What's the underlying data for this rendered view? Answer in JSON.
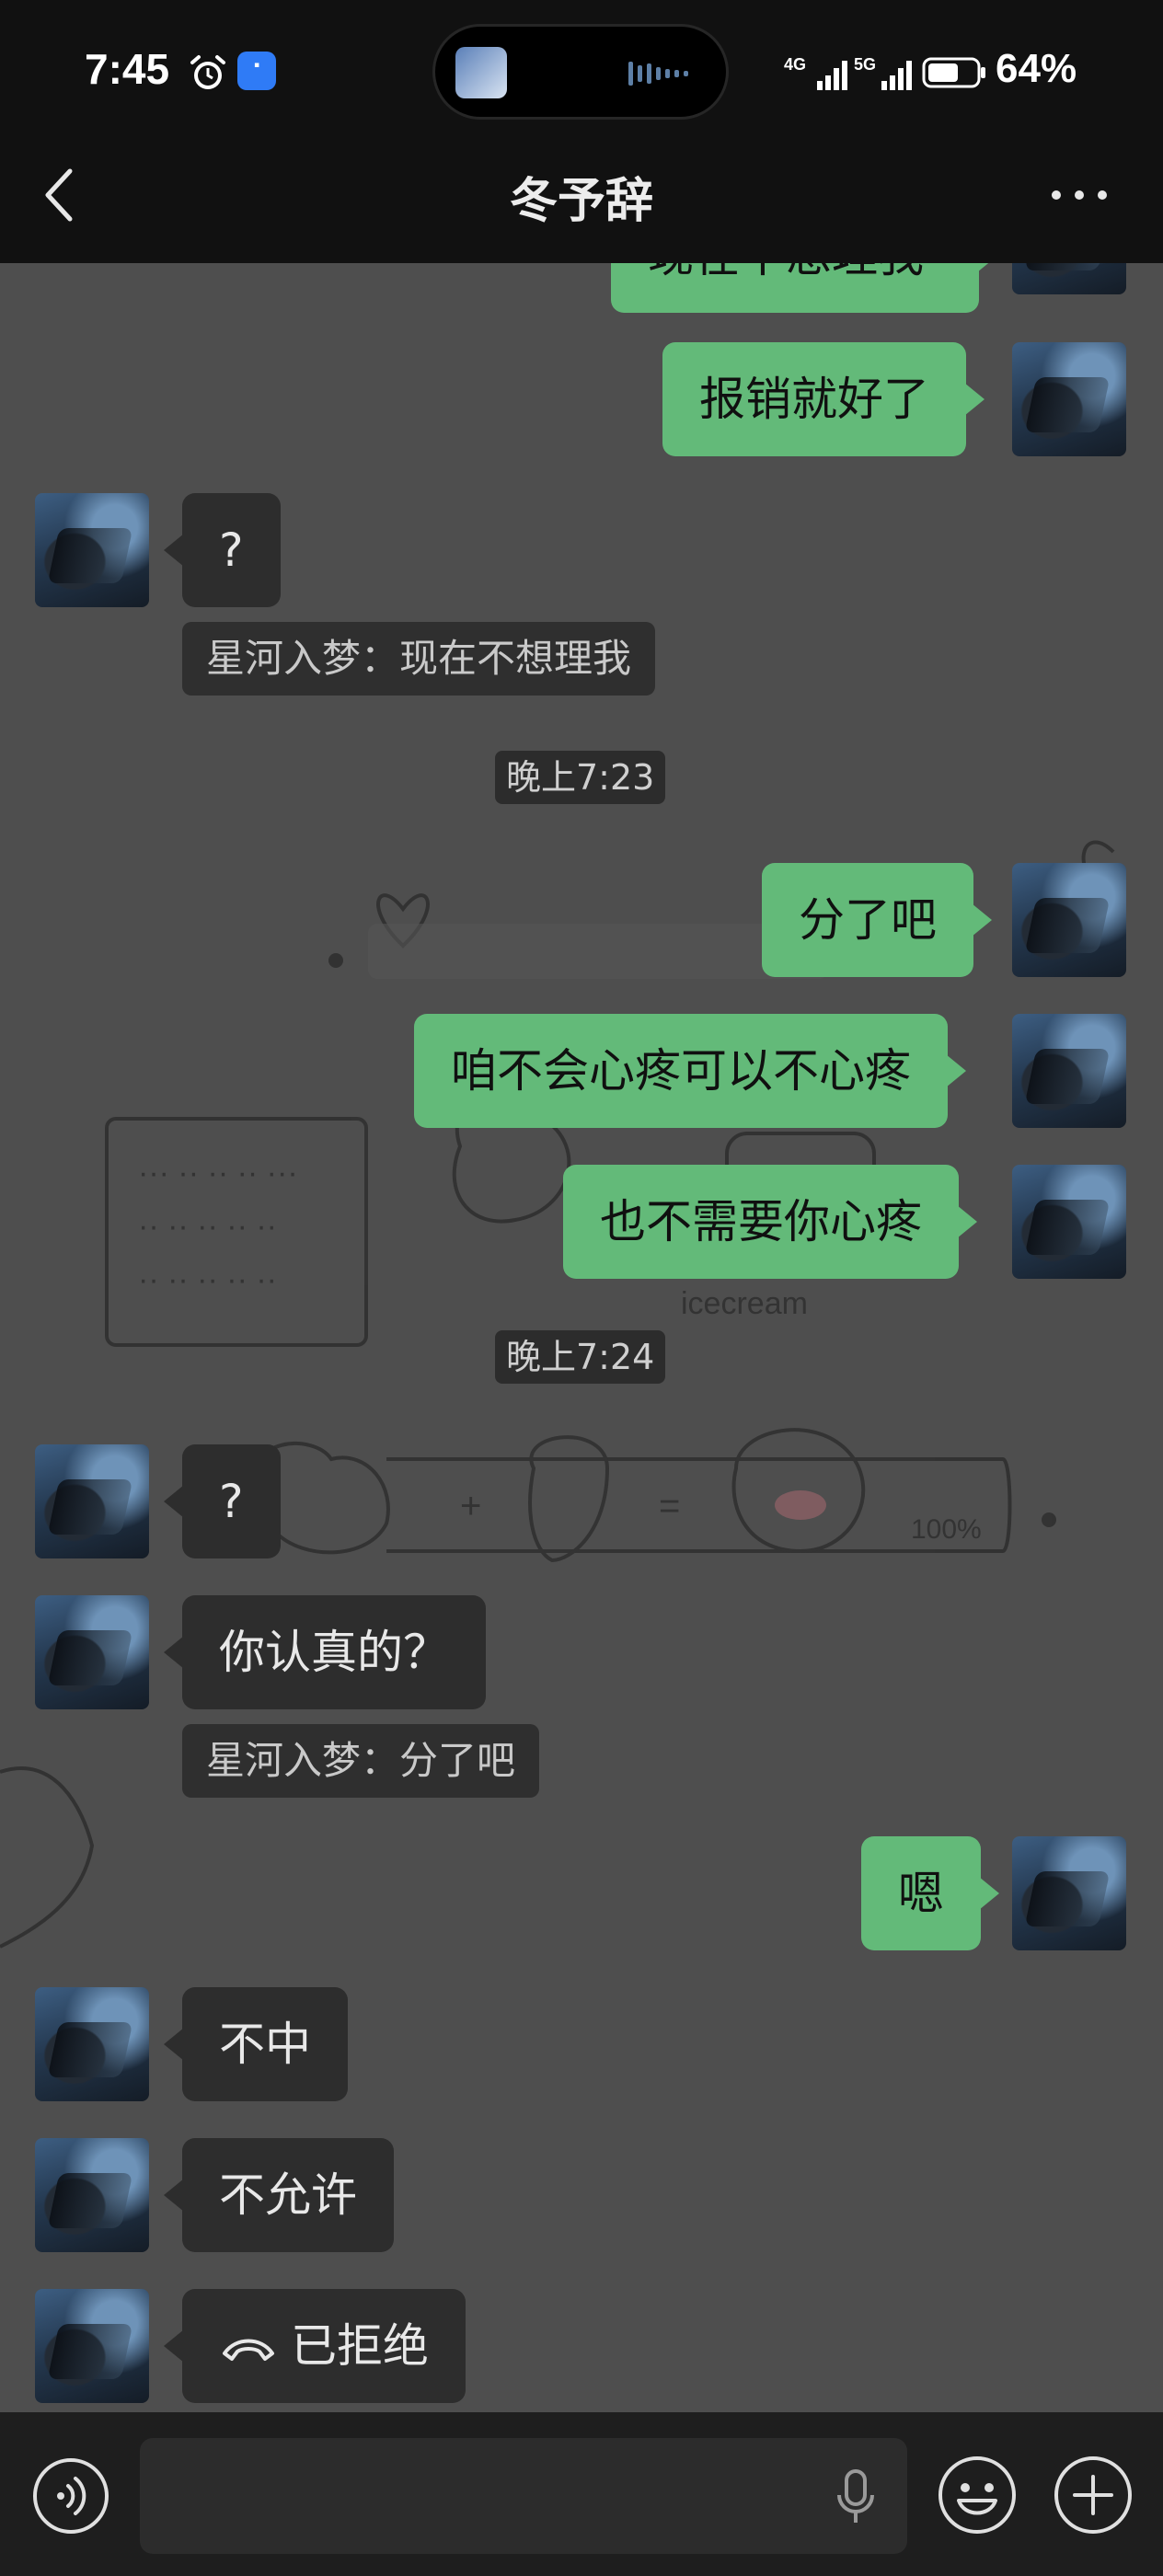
{
  "status_bar": {
    "time": "7:45",
    "battery_percent": "64%",
    "signal_1_label": "4G",
    "signal_2_label": "5G"
  },
  "nav": {
    "title": "冬予辞"
  },
  "messages": [
    {
      "side": "right",
      "text": "现在不想理我"
    },
    {
      "side": "right",
      "text": "报销就好了"
    },
    {
      "side": "left",
      "text": "?"
    },
    {
      "side": "quote",
      "text": "星河入梦：现在不想理我"
    },
    {
      "side": "time",
      "text": "晚上7:23"
    },
    {
      "side": "right",
      "text": "分了吧"
    },
    {
      "side": "right",
      "text": "咱不会心疼可以不心疼"
    },
    {
      "side": "right",
      "text": "也不需要你心疼"
    },
    {
      "side": "time",
      "text": "晚上7:24"
    },
    {
      "side": "left",
      "text": "?"
    },
    {
      "side": "left",
      "text": "你认真的？"
    },
    {
      "side": "quote",
      "text": "星河入梦：分了吧"
    },
    {
      "side": "right",
      "text": "嗯"
    },
    {
      "side": "left",
      "text": "不中"
    },
    {
      "side": "left",
      "text": "不允许"
    },
    {
      "side": "left",
      "text": "已拒绝",
      "icon": "declined-call-icon"
    }
  ],
  "colors": {
    "outgoing_bubble": "#63ba79",
    "incoming_bubble": "#2d2d2d",
    "chat_background": "#4e4e4e"
  }
}
